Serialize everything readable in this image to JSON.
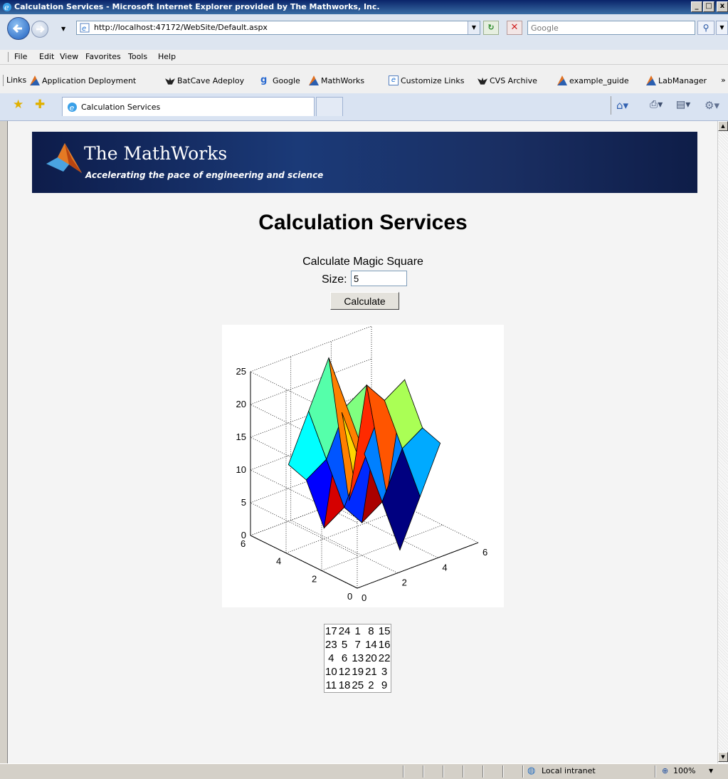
{
  "window": {
    "title": "Calculation Services - Microsoft Internet Explorer provided by The Mathworks, Inc."
  },
  "address": {
    "url": "http://localhost:47172/WebSite/Default.aspx"
  },
  "search": {
    "placeholder": "Google"
  },
  "menu": [
    "File",
    "Edit",
    "View",
    "Favorites",
    "Tools",
    "Help"
  ],
  "links": {
    "label": "Links",
    "items": [
      "Application Deployment",
      "BatCave Adeploy",
      "Google",
      "MathWorks",
      "Customize Links",
      "CVS Archive",
      "example_guide",
      "LabManager"
    ],
    "more": "»"
  },
  "tab": {
    "title": "Calculation Services"
  },
  "banner": {
    "name": "The MathWorks",
    "tagline": "Accelerating the pace of engineering and science"
  },
  "page": {
    "heading": "Calculation Services",
    "form_label": "Calculate Magic Square",
    "size_label": "Size:",
    "size_value": "5",
    "button_label": "Calculate"
  },
  "chart_data": {
    "type": "surface",
    "x": [
      1,
      2,
      3,
      4,
      5
    ],
    "y": [
      1,
      2,
      3,
      4,
      5
    ],
    "z": [
      [
        17,
        24,
        1,
        8,
        15
      ],
      [
        23,
        5,
        7,
        14,
        16
      ],
      [
        4,
        6,
        13,
        20,
        22
      ],
      [
        10,
        12,
        19,
        21,
        3
      ],
      [
        11,
        18,
        25,
        2,
        9
      ]
    ],
    "xlim": [
      0,
      6
    ],
    "ylim": [
      0,
      6
    ],
    "zlim": [
      0,
      25
    ],
    "x_ticks": [
      "0",
      "2",
      "4",
      "6"
    ],
    "y_ticks": [
      "0",
      "2",
      "4",
      "6"
    ],
    "z_ticks": [
      "0",
      "5",
      "10",
      "15",
      "20",
      "25"
    ],
    "grid": true,
    "colormap": "jet"
  },
  "magic_square": [
    [
      17,
      24,
      1,
      8,
      15
    ],
    [
      23,
      5,
      7,
      14,
      16
    ],
    [
      4,
      6,
      13,
      20,
      22
    ],
    [
      10,
      12,
      19,
      21,
      3
    ],
    [
      11,
      18,
      25,
      2,
      9
    ]
  ],
  "status": {
    "zone": "Local intranet",
    "zoom": "100%"
  }
}
